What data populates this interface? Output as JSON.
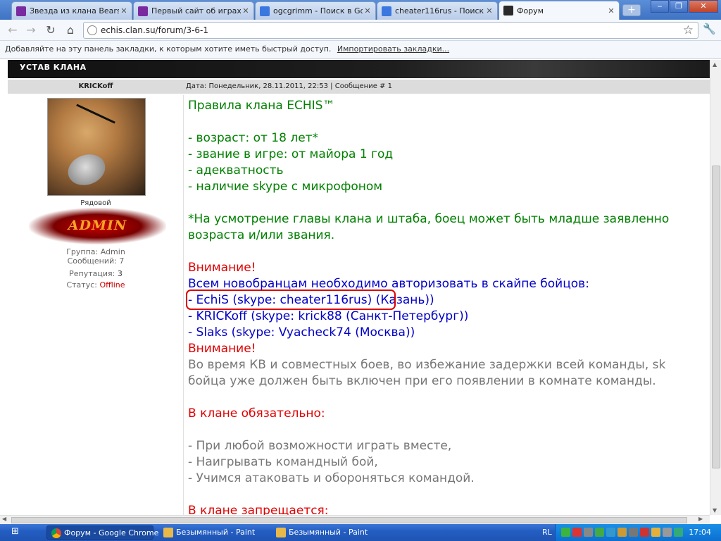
{
  "tabs": [
    {
      "title": "Звезда из клана Bears™",
      "icon": "purple-game-icon",
      "color": "#7a2aa0"
    },
    {
      "title": "Первый сайт об играх бе",
      "icon": "purple-game-icon",
      "color": "#7a2aa0"
    },
    {
      "title": "ogcgrimm - Поиск в Google",
      "icon": "google-icon",
      "color": "#3a78e0"
    },
    {
      "title": "cheater116rus - Поиск в G",
      "icon": "google-icon",
      "color": "#3a78e0"
    },
    {
      "title": "Форум",
      "icon": "forum-icon",
      "color": "#2a2a2a"
    }
  ],
  "toolbar": {
    "back": "←",
    "forward": "→",
    "reload": "↻",
    "home": "⌂",
    "url": "echis.clan.su/forum/3-6-1",
    "star": "☆",
    "wrench": "🔧"
  },
  "bookmarks": {
    "text": "Добавляйте на эту панель закладки, к которым хотите иметь быстрый доступ.",
    "import_link": "Импортировать закладки..."
  },
  "forum": {
    "section_title": "УСТАВ КЛАНА",
    "author": "KRICKoff",
    "post_meta": "Дата: Понедельник, 28.11.2011, 22:53 | Сообщение # 1",
    "rank": "Рядовой",
    "admin_logo": "ADMIN",
    "group": "Группа: Admin",
    "messages": "Сообщений: 7",
    "reputation_label": "Репутация: ",
    "reputation_value": "3",
    "status_label": "Статус: ",
    "status_value": "Offline"
  },
  "post": {
    "l1": "Правила клана ECHIS™",
    "l2": "",
    "l3": "- возраст: от 18 лет*",
    "l4": "- звание в игре: от майора 1 год",
    "l5": "- адекватность",
    "l6": "- наличие skype с микрофоном",
    "l7": "",
    "l8": "*На усмотрение главы клана и штаба, боец может быть младше заявленно",
    "l9": "возраста и/или звания.",
    "l10": "",
    "l11": "Внимание!",
    "l12": "Всем новобранцам необходимо авторизовать в скайпе бойцов:",
    "l13": "- EchiS (skype: cheater116rus) (Казань))",
    "l14": "- KRICKoff (skype: krick88 (Санкт-Петербург))",
    "l15": "- Slaks (skype: Vyacheck74 (Москва))",
    "l16": "Внимание!",
    "l17": "Во время КВ и совместных боев, во избежание задержки всей команды, sk",
    "l18": "бойца уже должен быть включен при его появлении в комнате команды.",
    "l19": "",
    "l20": "В клане обязательно:",
    "l21": "",
    "l22": "- При любой возможности играть вместе,",
    "l23": "- Наигрывать командный бой,",
    "l24": "- Учимся атаковать и обороняться командой.",
    "l25": "",
    "l26": "В клане запрещается:"
  },
  "taskbar": {
    "tasks": [
      "Форум - Google Chrome",
      "Безымянный - Paint",
      "Безымянный - Paint"
    ],
    "lang": "RL",
    "clock": "17:04"
  }
}
